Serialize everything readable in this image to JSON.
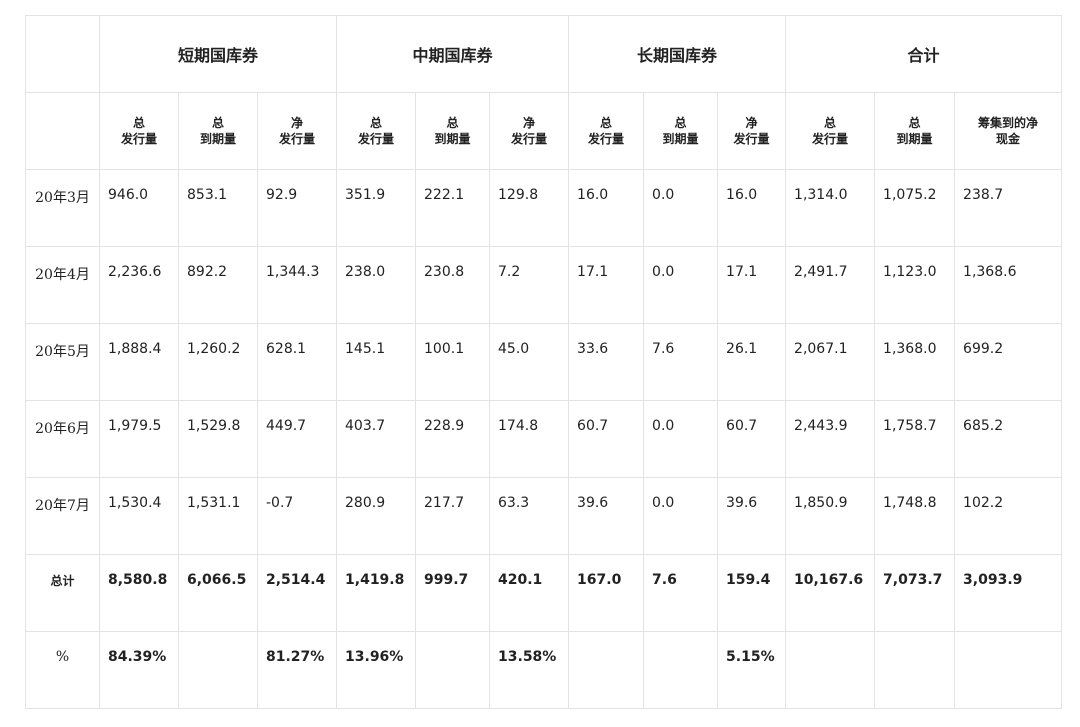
{
  "groups": [
    {
      "label": "短期国库券"
    },
    {
      "label": "中期国库券"
    },
    {
      "label": "长期国库券"
    },
    {
      "label": "合计"
    }
  ],
  "subheaders": [
    [
      "总",
      "发行量"
    ],
    [
      "总",
      "到期量"
    ],
    [
      "净",
      "发行量"
    ],
    [
      "总",
      "发行量"
    ],
    [
      "总",
      "到期量"
    ],
    [
      "净",
      "发行量"
    ],
    [
      "总",
      "发行量"
    ],
    [
      "总",
      "到期量"
    ],
    [
      "净",
      "发行量"
    ],
    [
      "总",
      "发行量"
    ],
    [
      "总",
      "到期量"
    ],
    [
      "筹集到的净",
      "现金"
    ]
  ],
  "rows": [
    {
      "label": "20年3月",
      "values": [
        "946.0",
        "853.1",
        "92.9",
        "351.9",
        "222.1",
        "129.8",
        "16.0",
        "0.0",
        "16.0",
        "1,314.0",
        "1,075.2",
        "238.7"
      ]
    },
    {
      "label": "20年4月",
      "values": [
        "2,236.6",
        "892.2",
        "1,344.3",
        "238.0",
        "230.8",
        "7.2",
        "17.1",
        "0.0",
        "17.1",
        "2,491.7",
        "1,123.0",
        "1,368.6"
      ]
    },
    {
      "label": "20年5月",
      "values": [
        "1,888.4",
        "1,260.2",
        "628.1",
        "145.1",
        "100.1",
        "45.0",
        "33.6",
        "7.6",
        "26.1",
        "2,067.1",
        "1,368.0",
        "699.2"
      ]
    },
    {
      "label": "20年6月",
      "values": [
        "1,979.5",
        "1,529.8",
        "449.7",
        "403.7",
        "228.9",
        "174.8",
        "60.7",
        "0.0",
        "60.7",
        "2,443.9",
        "1,758.7",
        "685.2"
      ]
    },
    {
      "label": "20年7月",
      "values": [
        "1,530.4",
        "1,531.1",
        "-0.7",
        "280.9",
        "217.7",
        "63.3",
        "39.6",
        "0.0",
        "39.6",
        "1,850.9",
        "1,748.8",
        "102.2"
      ]
    }
  ],
  "total": {
    "label": "总计",
    "values": [
      "8,580.8",
      "6,066.5",
      "2,514.4",
      "1,419.8",
      "999.7",
      "420.1",
      "167.0",
      "7.6",
      "159.4",
      "10,167.6",
      "7,073.7",
      "3,093.9"
    ]
  },
  "percent": {
    "label": "%",
    "values": [
      "84.39%",
      "",
      "81.27%",
      "13.96%",
      "",
      "13.58%",
      "",
      "",
      "5.15%",
      "",
      "",
      ""
    ]
  }
}
